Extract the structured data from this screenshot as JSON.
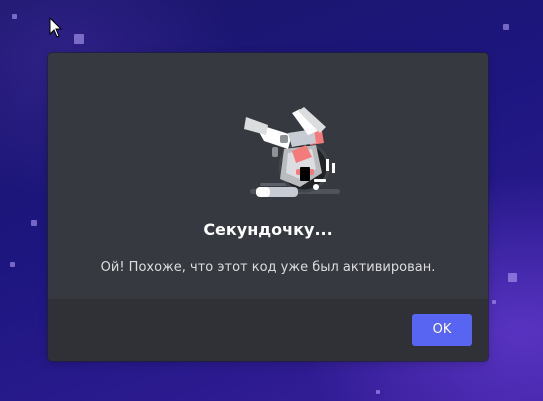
{
  "dialog": {
    "title": "Секундочку...",
    "message": "Ой! Похоже, что этот код уже был активирован.",
    "ok_label": "OK"
  },
  "colors": {
    "modal_background": "#36393f",
    "footer_background": "#2f3136",
    "button_background": "#5865f2",
    "title_text": "#ffffff",
    "message_text": "#dcddde",
    "backdrop": "#1d1680"
  },
  "icons": {
    "cursor": "mouse-pointer-icon",
    "illustration": "robot-hand-illustration"
  }
}
